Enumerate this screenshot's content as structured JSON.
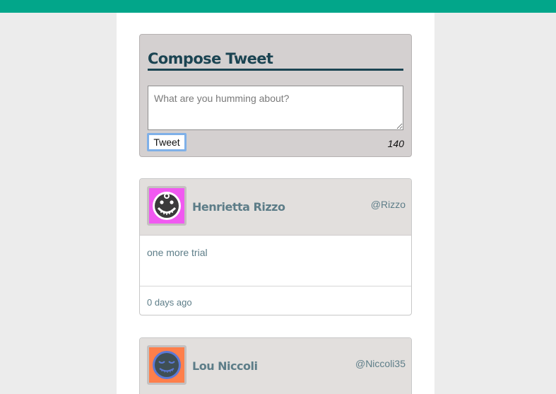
{
  "compose": {
    "title": "Compose Tweet",
    "placeholder": "What are you humming about?",
    "value": "",
    "button_label": "Tweet",
    "counter": "140"
  },
  "tweets": [
    {
      "name": "Henrietta Rizzo",
      "handle": "@Rizzo",
      "text": "one more trial",
      "time": "0 days ago",
      "avatar_bg": "#f159f1",
      "avatar_icon": "grinning-face-avatar-icon"
    },
    {
      "name": "Lou Niccoli",
      "handle": "@Niccoli35",
      "avatar_bg": "#ff7f4b",
      "avatar_icon": "sleeping-face-avatar-icon"
    }
  ],
  "colors": {
    "topbar": "#02a68a",
    "accent_text": "#5d7d88",
    "title": "#1b4452"
  }
}
